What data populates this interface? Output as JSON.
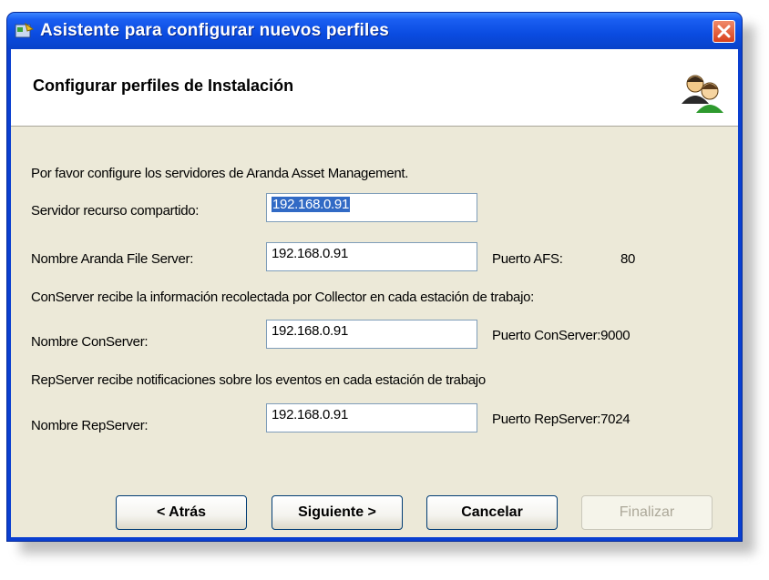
{
  "window": {
    "title": "Asistente para configurar nuevos perfiles"
  },
  "header": {
    "title": "Configurar perfiles de Instalación"
  },
  "intro_text": "Por favor configure los servidores de Aranda Asset Management.",
  "fields": {
    "servidor_recurso": {
      "label": "Servidor recurso compartido:",
      "value": "192.168.0.91"
    },
    "file_server": {
      "label": "Nombre Aranda File Server:",
      "value": "192.168.0.91",
      "port_label": "Puerto AFS:",
      "port_value": "80"
    },
    "conserver_note": "ConServer recibe la información recolectada por Collector en cada estación de trabajo:",
    "conserver": {
      "label": "Nombre ConServer:",
      "value": "192.168.0.91",
      "port_text": "Puerto ConServer:9000"
    },
    "repserver_note": "RepServer recibe notificaciones sobre los eventos en cada estación de trabajo",
    "repserver": {
      "label": "Nombre RepServer:",
      "value": "192.168.0.91",
      "port_text": "Puerto RepServer:7024"
    }
  },
  "buttons": {
    "back": "< Atrás",
    "next": "Siguiente >",
    "cancel": "Cancelar",
    "finish": "Finalizar"
  },
  "icons": [
    "app-icon",
    "close-icon",
    "users-icon"
  ],
  "colors": {
    "titlebar": "#0a4be0",
    "frame": "#ece9d8",
    "close": "#d8401c",
    "selection": "#316ac5"
  }
}
